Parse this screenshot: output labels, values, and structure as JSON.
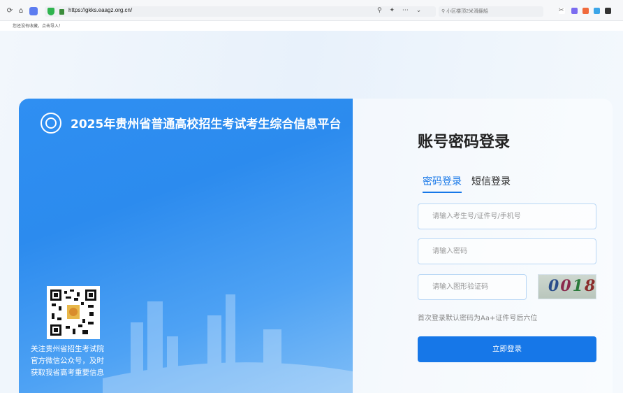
{
  "browser": {
    "url": "https://gkks.eaagz.org.cn/",
    "search_placeholder": "小区楼顶2米滑翻船",
    "bookmarks_notice": "您还没有收藏，点击导入！"
  },
  "left": {
    "title": "2025年贵州省普通高校招生考试考生综合信息平台",
    "follow_lines": [
      "关注贵州省招生考试院",
      "官方微信公众号，及时",
      "获取我省高考重要信息"
    ]
  },
  "form": {
    "title": "账号密码登录",
    "tabs": [
      {
        "label": "密码登录",
        "active": true
      },
      {
        "label": "短信登录",
        "active": false
      }
    ],
    "username_placeholder": "请输入考生号/证件号/手机号",
    "password_placeholder": "请输入密码",
    "captcha_placeholder": "请输入图形验证码",
    "captcha_text": "0018",
    "hint": "首次登录默认密码为Aa+证件号后六位",
    "login_label": "立即登录"
  },
  "colors": {
    "primary": "#1677e8",
    "panel_blue": "#2f8ff2"
  }
}
